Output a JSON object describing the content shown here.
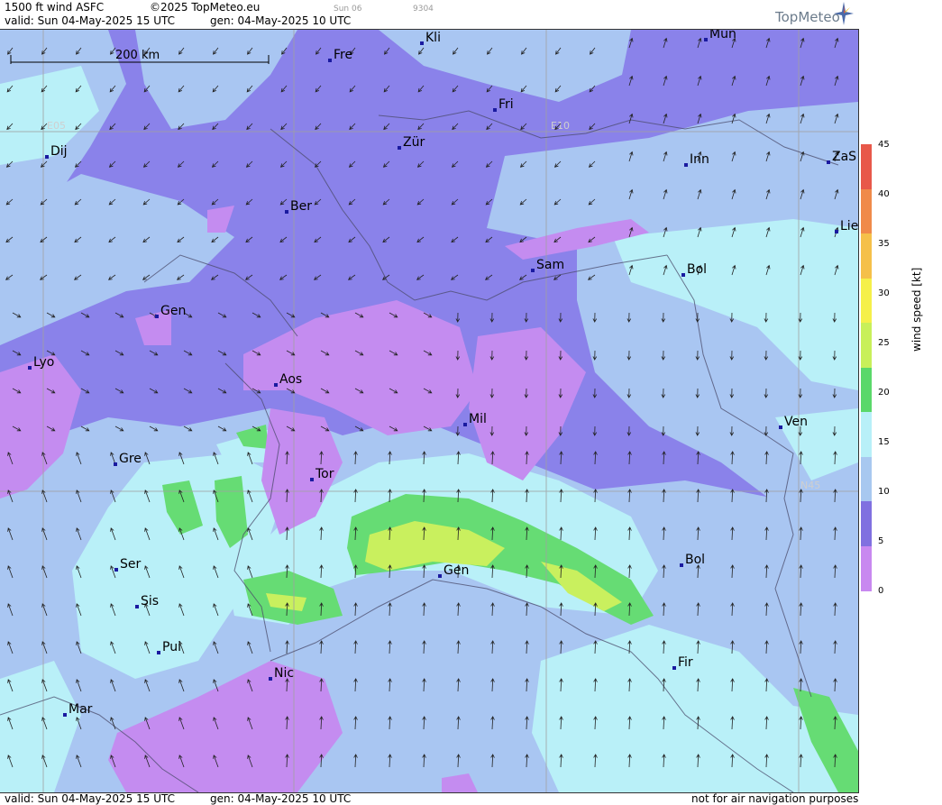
{
  "header": {
    "product": "1500 ft wind ASFC",
    "copyright": "©2025 TopMeteo.eu",
    "valid": "valid:  Sun  04-May-2025  15 UTC",
    "generated": "gen:  04-May-2025  10 UTC",
    "next_day": "Sun 06",
    "code": "9304",
    "logo": "TopMeteo"
  },
  "footer": {
    "valid": "valid:  Sun  04-May-2025  15 UTC",
    "generated": "gen: 04-May-2025 10 UTC",
    "disclaimer": "not for air navigation purposes"
  },
  "map": {
    "scale_label": "200 km",
    "grid_labels": [
      "E05",
      "E10",
      "N45"
    ],
    "cities": [
      "Kli",
      "Mün",
      "Fre",
      "Fri",
      "Dij",
      "Zür",
      "Inn",
      "ZaS",
      "Ber",
      "Lie",
      "Sam",
      "Bol",
      "Gen",
      "Lyo",
      "Aos",
      "Mil",
      "Ven",
      "Gre",
      "Tor",
      "Ser",
      "Gen",
      "Bol",
      "Sis",
      "Pui",
      "Nic",
      "Fir",
      "Mar"
    ]
  },
  "legend": {
    "title": "wind speed [kt]",
    "ticks": [
      "45",
      "40",
      "35",
      "30",
      "25",
      "20",
      "15",
      "10",
      "5",
      "0"
    ],
    "colors": [
      "#e8584a",
      "#f08a4a",
      "#f5c04a",
      "#f5f04a",
      "#c8f05a",
      "#5ad86a",
      "#b8f0f8",
      "#a8c8f0",
      "#8070e0",
      "#c888f0"
    ]
  }
}
